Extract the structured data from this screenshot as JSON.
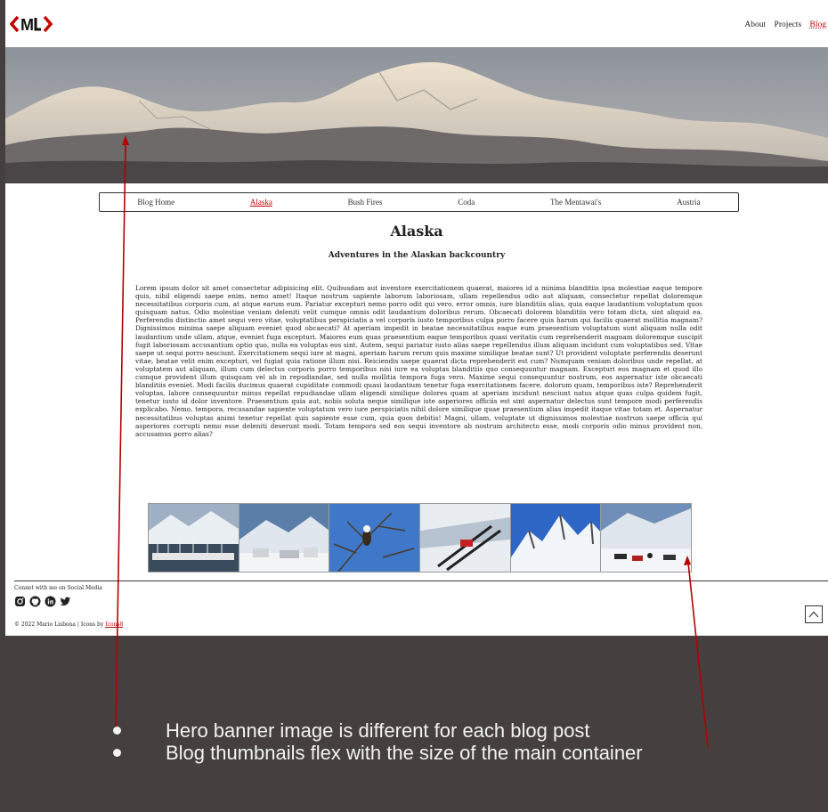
{
  "site": {
    "logo_text": "<ML>",
    "top_nav": [
      {
        "label": "About",
        "active": false
      },
      {
        "label": "Projects",
        "active": false
      },
      {
        "label": "Blog",
        "active": true
      }
    ]
  },
  "blog_nav": [
    {
      "label": "Blog Home",
      "active": false
    },
    {
      "label": "Alaska",
      "active": true
    },
    {
      "label": "Bush Fires",
      "active": false
    },
    {
      "label": "Coda",
      "active": false
    },
    {
      "label": "The Mentawai's",
      "active": false
    },
    {
      "label": "Austria",
      "active": false
    }
  ],
  "post": {
    "title": "Alaska",
    "subtitle": "Adventures in the Alaskan backcountry",
    "body": "Lorem ipsum dolor sit amet consectetur adipisicing elit. Quibusdam aut inventore exercitationem quaerat, maiores id a minima blanditiis ipsa molestiae eaque tempore quis, nihil eligendi saepe enim, nemo amet! Itaque nostrum sapiente laborum laboriosam, ullam repellendus odio aut aliquam, consectetur repellat doloremque necessitatibus corporis cum, at atque earum eum. Pariatur excepturi nemo porro odit qui vero, error omnis, iure blanditiis alias, quia eaque laudantium voluptatum quos quisquam natus. Odio molestiae veniam deleniti velit cumque omnis odit laudantium doloribus rerum. Obcaecati dolorem blanditiis vero totam dicta, sint aliquid ea. Perferendis distinctio amet sequi vero vitae, voluptatibus perspiciatis a vel corporis iusto temporibus culpa porro facere quis harum qui facilis quaerat mollitia magnam? Dignissimos minima saepe aliquam eveniet quod obcaecati? At aperiam impedit in beatae necessitatibus eaque eum praesentium voluptatum sunt aliquam nulla odit laudantium unde ullam, atque, eveniet fuga excepturi. Maiores eum quas praesentium eaque temporibus quasi veritatis cum reprehenderit magnam doloremque suscipit fugit laboriosam accusantium optio quo, nulla ea voluptas eos sint. Autem, sequi pariatur iusto alias saepe repellendus illum aliquam incidunt cum voluptatibus sed. Vitae saepe ut sequi porro nesciunt. Exercitationem sequi iure at magni, aperiam harum rerum quis maxime similique beatae sunt? Ut provident voluptate perferendis deserunt vitae, beatae velit enim excepturi, vel fugiat quia ratione illum nisi. Reiciendis saepe quaerat dicta reprehenderit est cum? Numquam veniam doloribus unde repellat, at voluptatem aut aliquam, illum cum delectus corporis porro temporibus nisi iure ea voluptas blanditiis quo consequuntur magnam. Excepturi eos magnam et quod illo cumque provident illum quisquam vel ab in repudiandae, sed nulla mollitia tempora fuga vero. Maxime sequi consequuntur nostrum, eos aspernatur iste obcaecati blanditiis eveniet. Modi facilis ducimus quaerat cupiditate commodi quasi laudantium tenetur fuga exercitationem facere, dolorum quam, temporibus iste? Reprehenderit voluptas, labore consequuntur minus repellat repudiandae ullam eligendi similique dolores quam at aperiam incidunt nesciunt natus atque quas culpa quidem fugit, tenetur iusto id dolor inventore. Praesentium quia aut, nobis soluta neque similique iste asperiores officiis est sint aspernatur delectus sunt tempore modi perferendis explicabo. Nemo, tempora, recusandae sapiente voluptatum vero iure perspiciatis nihil dolore similique quae praesentium alias impedit itaque vitae totam et. Aspernatur necessitatibus voluptas animi tenetur repellat quis sapiente esse cum, quia quos debitis! Magni, ullam, voluptate ut dignissimos molestiae nostrum saepe officia qui asperiores corrupti nemo esse deleniti deserunt modi. Totam tempora sed eos sequi inventore ab nostrum architecto esse, modi corporis odio minus provident non, accusamus porro alias?"
  },
  "thumbnails": [
    {
      "icon": "harbor-boats-thumbnail"
    },
    {
      "icon": "snow-camp-thumbnail"
    },
    {
      "icon": "bald-eagle-thumbnail"
    },
    {
      "icon": "ski-plane-thumbnail"
    },
    {
      "icon": "snow-ridge-thumbnail"
    },
    {
      "icon": "snowmobiles-thumbnail"
    }
  ],
  "footer": {
    "social_label": "Connet with me on Social Media",
    "social_icons": [
      "instagram-icon",
      "github-icon",
      "linkedin-icon",
      "twitter-icon"
    ],
    "copyright_prefix": "© 2022 Mario Lisbona | Icons by ",
    "copyright_link": "Icons8"
  },
  "annotations": [
    "Hero banner image is different for each blog post",
    "Blog thumbnails flex with the size of the main container"
  ],
  "colors": {
    "accent": "#c40000",
    "slide_background": "#45403f",
    "arrow": "#b30000"
  }
}
